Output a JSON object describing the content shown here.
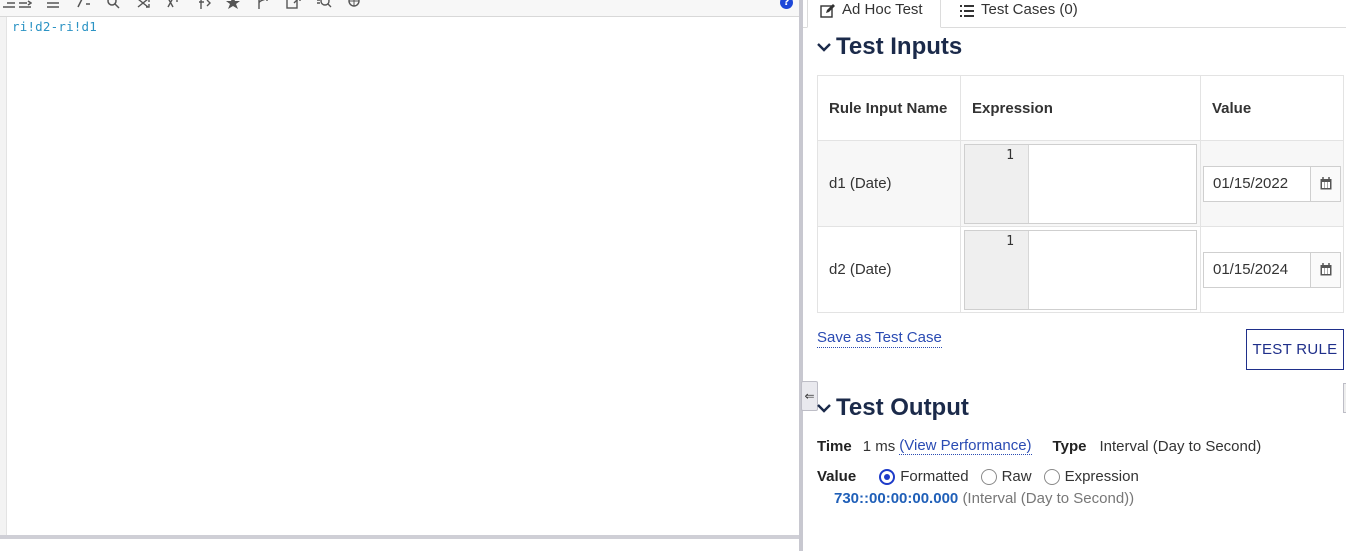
{
  "editor": {
    "code": "ri!d2-ri!d1",
    "toolbar_icons": [
      "indent-icon",
      "outdent-icon",
      "list-icon",
      "comment-icon",
      "search-icon",
      "shuffle-icon",
      "variable-icon",
      "function-icon",
      "star-icon",
      "fork-icon",
      "export-icon",
      "zoom-icon",
      "globe-icon"
    ],
    "help_label": "?",
    "collapse_glyph": "⇐"
  },
  "tabs": [
    {
      "label": "Ad Hoc Test",
      "icon": "edit-icon",
      "active": true
    },
    {
      "label": "Test Cases (0)",
      "icon": "list-icon",
      "active": false
    }
  ],
  "test_inputs": {
    "title": "Test Inputs",
    "columns": [
      "Rule Input Name",
      "Expression",
      "Value"
    ],
    "rows": [
      {
        "name": "d1 (Date)",
        "line_number": "1",
        "value": "01/15/2022"
      },
      {
        "name": "d2 (Date)",
        "line_number": "1",
        "value": "01/15/2024"
      }
    ],
    "save_link": "Save as Test Case",
    "test_button": "TEST RULE"
  },
  "test_output": {
    "title": "Test Output",
    "time_label": "Time",
    "time_value": "1 ms",
    "perf_link": "(View Performance)",
    "type_label": "Type",
    "type_value": "Interval (Day to Second)",
    "value_label": "Value",
    "value_modes": [
      {
        "label": "Formatted",
        "selected": true
      },
      {
        "label": "Raw",
        "selected": false
      },
      {
        "label": "Expression",
        "selected": false
      }
    ],
    "result_value": "730::00:00:00.000",
    "result_type": "(Interval (Day to Second))"
  },
  "colors": {
    "accent": "#1d3bc9",
    "link": "#2a4bb3",
    "heading": "#1b2a4a",
    "code": "#2b93c4"
  }
}
